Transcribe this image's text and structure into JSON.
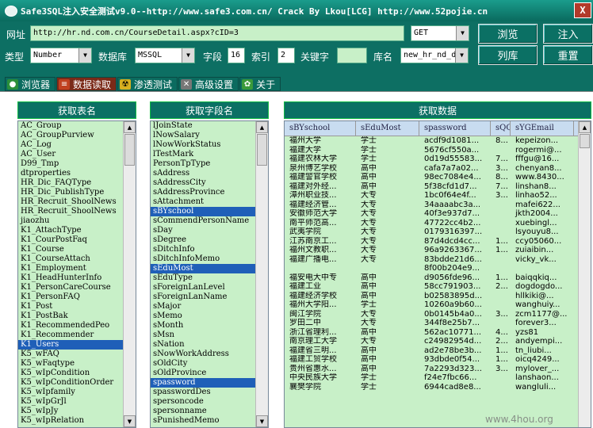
{
  "title": "Safe3SQL注入安全测试v9.0--http://www.safe3.com.cn/  Crack By Lkou[LCG]  http://www.52pojie.cn",
  "close_label": "X",
  "toolbar": {
    "url_label": "网址",
    "url_value": "http://hr.nd.com.cn/CourseDetail.aspx?cID=3",
    "method_value": "GET",
    "browse_label": "浏览",
    "inject_label": "注入",
    "type_label": "类型",
    "type_value": "Number",
    "db_label": "数据库",
    "db_value": "MSSQL",
    "field_label": "字段",
    "field_value": "16",
    "index_label": "索引",
    "index_value": "2",
    "keyword_label": "关键字",
    "keyword_value": "",
    "dbname_label": "库名",
    "dbname_value": "new_hr_nd_d",
    "listdb_label": "列库",
    "reset_label": "重置"
  },
  "tabs": [
    {
      "label": "浏览器",
      "icon": "globe-icon"
    },
    {
      "label": "数据读取",
      "icon": "database-icon"
    },
    {
      "label": "渗透测试",
      "icon": "radiation-icon"
    },
    {
      "label": "高级设置",
      "icon": "tools-icon"
    },
    {
      "label": "关于",
      "icon": "gear-icon"
    }
  ],
  "tables_panel": {
    "title": "获取表名",
    "selected": "K1_Users",
    "items": [
      "AC_Group",
      "AC_GroupPurview",
      "AC_Log",
      "AC_User",
      "D99_Tmp",
      "dtproperties",
      "HR_Dic_FAQType",
      "HR_Dic_PublishType",
      "HR_Recruit_ShoolNews",
      "HR_Recruit_ShoolNews",
      "jiaozhu",
      "K1_AttachType",
      "K1_CourPostFaq",
      "K1_Course",
      "K1_CourseAttach",
      "K1_Employment",
      "K1_HeadHunterInfo",
      "K1_PersonCareCourse",
      "K1_PersonFAQ",
      "K1_Post",
      "K1_PostBak",
      "K1_RecommendedPeo",
      "K1_Recommender",
      "K1_Users",
      "K5_wFAQ",
      "K5_wFaqtype",
      "K5_wIpCondition",
      "K5_wIpConditionOrder",
      "K5_wIpfamily",
      "K5_wIpGrJl",
      "K5_wIpJy",
      "K5_wIpRelation"
    ]
  },
  "fields_panel": {
    "title": "获取字段名",
    "selected": [
      "sBYschool",
      "sEduMost",
      "spassword"
    ],
    "items": [
      "lJoinState",
      "lNowSalary",
      "lNowWorkStatus",
      "lTestMark",
      "PersonTpType",
      "sAddress",
      "sAddressCity",
      "sAddressProvince",
      "sAttachment",
      "sBYschool",
      "sCommendPersonName",
      "sDay",
      "sDegree",
      "sDitchInfo",
      "sDitchInfoMemo",
      "sEduMost",
      "sEduType",
      "sForeignLanLevel",
      "sForeignLanName",
      "sMajor",
      "sMemo",
      "sMonth",
      "sMsn",
      "sNation",
      "sNowWorkAddress",
      "sOldCity",
      "sOldProvince",
      "spassword",
      "spasswordDes",
      "spersoncode",
      "spersonname",
      "sPunishedMemo"
    ]
  },
  "data_panel": {
    "title": "获取数据",
    "columns": [
      "sBYschool",
      "sEduMost",
      "spassword",
      "sQQ",
      "sYGEmail"
    ],
    "rows": [
      [
        "福州大学",
        "学士",
        "acdf9d1081...",
        "8...",
        "kepeizon..."
      ],
      [
        "福建大学",
        "学士",
        "5676cf550a...",
        "",
        "rogermi@..."
      ],
      [
        "福建农林大学",
        "学士",
        "0d19d55583...",
        "7...",
        "fffgu@16..."
      ],
      [
        "泉州博艺学校",
        "高中",
        "cafa7a7a02...",
        "3...",
        "chenyan8..."
      ],
      [
        "福建警官学校",
        "高中",
        "98ec7084e4...",
        "8...",
        "www.8430..."
      ],
      [
        "福建对外经...",
        "高中",
        "5f38cfd1d7...",
        "7...",
        "linshan8..."
      ],
      [
        "漳州职业技...",
        "大专",
        "1bc0f64e4f...",
        "3...",
        "linhao52..."
      ],
      [
        "福建经济管...",
        "大专",
        "34aaaabc3a...",
        "",
        "mafei622..."
      ],
      [
        "安徽师范大学",
        "大专",
        "40f3e937d7...",
        "",
        "jkth2004..."
      ],
      [
        "南平师范高...",
        "大专",
        "47722cc4b2...",
        "",
        "xuebingl..."
      ],
      [
        "武夷学院",
        "大专",
        "0179316397...",
        "",
        "lsyouyu8..."
      ],
      [
        "江苏南京工...",
        "大专",
        "87d4dcd4cc...",
        "1...",
        "ccy05060..."
      ],
      [
        "福州文教职...",
        "大专",
        "96a9263367...",
        "1...",
        "zuiaibin..."
      ],
      [
        "福建广播电...",
        "大专",
        "83bdde21d6...",
        "",
        "vicky_vk..."
      ],
      [
        "",
        "",
        "8f00b204e9...",
        "",
        ""
      ],
      [
        "福安电大中专",
        "高中",
        "d9056fde96...",
        "1...",
        "baiqqkiq..."
      ],
      [
        "福建工业",
        "高中",
        "58cc791903...",
        "2...",
        "dogdogdo..."
      ],
      [
        "福建经济学校",
        "高中",
        "b02583895d...",
        "",
        "hllkiki@..."
      ],
      [
        "福州大学阳...",
        "学士",
        "10260a9b60...",
        "",
        "wanghuiy..."
      ],
      [
        "闽江学院",
        "大专",
        "0b0145b4a0...",
        "3...",
        "zcm1177@..."
      ],
      [
        "罗田二中",
        "大专",
        "344f8e25b7...",
        "",
        "forever3..."
      ],
      [
        "浙江省理利...",
        "高中",
        "562ac10771...",
        "4...",
        "yzs81"
      ],
      [
        "南京理工大学",
        "大专",
        "c24982954d...",
        "2...",
        "andyempi..."
      ],
      [
        "福建省三明...",
        "高中",
        "ad2e78be3b...",
        "1...",
        "tn_liubi..."
      ],
      [
        "福建工贸学校",
        "高中",
        "93dbde0f54...",
        "1...",
        "oicq4249..."
      ],
      [
        "贵州省惠水...",
        "高中",
        "7a2293d323...",
        "3...",
        "mylover_..."
      ],
      [
        "中央民族大学",
        "学士",
        "f24e7fbc66...",
        "",
        "lanshaon..."
      ],
      [
        "襄樊学院",
        "学士",
        "6944cad8e8...",
        "",
        "wangluli..."
      ]
    ]
  },
  "watermark": "www.4hou.org"
}
